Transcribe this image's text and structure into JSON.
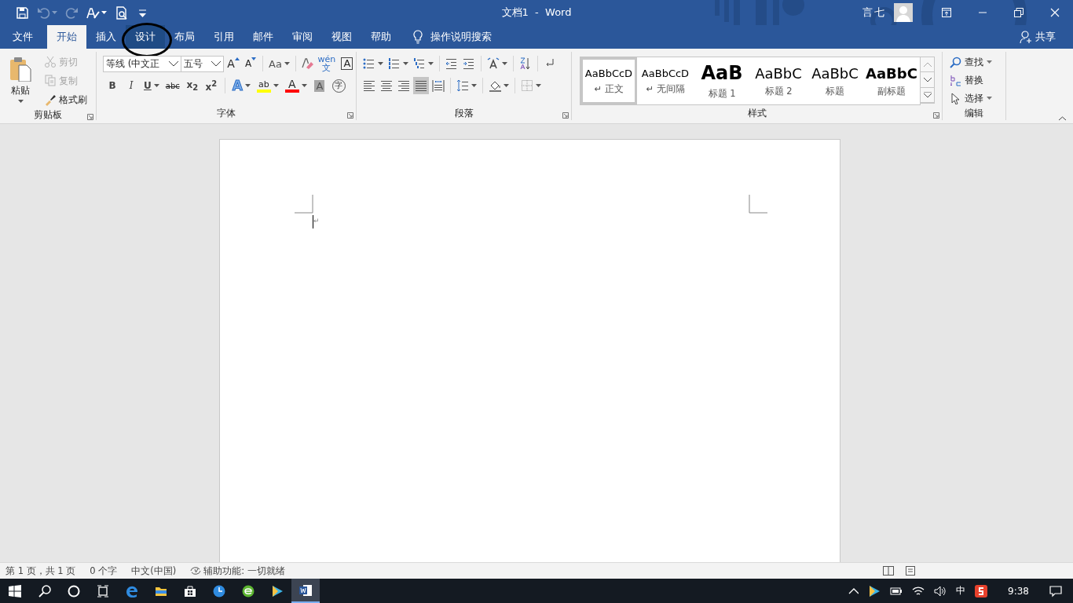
{
  "quick_access": [
    {
      "kind": "save",
      "disabled": false
    },
    {
      "kind": "undo",
      "disabled": true
    },
    {
      "kind": "redo",
      "disabled": true
    },
    {
      "kind": "spelling",
      "disabled": false
    },
    {
      "kind": "print-preview",
      "disabled": false
    },
    {
      "kind": "customize",
      "disabled": false
    }
  ],
  "window": {
    "title": "文档1  -  Word",
    "user": "言七"
  },
  "tabs": [
    {
      "label": "文件",
      "selected": false,
      "highlighted": false
    },
    {
      "label": "开始",
      "selected": true,
      "highlighted": false
    },
    {
      "label": "插入",
      "selected": false,
      "highlighted": false
    },
    {
      "label": "设计",
      "selected": false,
      "highlighted": true
    },
    {
      "label": "布局",
      "selected": false,
      "highlighted": false
    },
    {
      "label": "引用",
      "selected": false,
      "highlighted": false
    },
    {
      "label": "邮件",
      "selected": false,
      "highlighted": false
    },
    {
      "label": "审阅",
      "selected": false,
      "highlighted": false
    },
    {
      "label": "视图",
      "selected": false,
      "highlighted": false
    },
    {
      "label": "帮助",
      "selected": false,
      "highlighted": false
    }
  ],
  "tell_me": "操作说明搜索",
  "share": "共享",
  "clipboard": {
    "title": "剪贴板",
    "paste": "粘贴",
    "items": [
      {
        "kind": "cut",
        "label": "剪切",
        "disabled": true
      },
      {
        "kind": "copy",
        "label": "复制",
        "disabled": true
      },
      {
        "kind": "format-painter",
        "label": "格式刷",
        "disabled": false
      }
    ]
  },
  "font": {
    "title": "字体",
    "font_name": "等线 (中文正",
    "font_size": "五号",
    "row_1": [
      {
        "kind": "grow",
        "label": "A"
      },
      {
        "kind": "shrink",
        "label": "A"
      },
      {
        "kind": "case",
        "label": "Aa"
      },
      {
        "kind": "clear"
      },
      {
        "kind": "phonetic",
        "label": "wén文"
      },
      {
        "kind": "border",
        "label": "A"
      }
    ],
    "row_2": [
      {
        "kind": "bold",
        "label": "B"
      },
      {
        "kind": "italic",
        "label": "I"
      },
      {
        "kind": "underline",
        "label": "U"
      },
      {
        "kind": "strike",
        "label": "abc"
      },
      {
        "kind": "sub",
        "label": "x$_{2}$"
      },
      {
        "kind": "super",
        "label": "x$^{2}$"
      },
      {
        "kind": "effects",
        "label": "A"
      },
      {
        "kind": "highlight",
        "label": "ab",
        "color": "#ffff00"
      },
      {
        "kind": "color",
        "label": "A",
        "color": "#ff0000"
      },
      {
        "kind": "shading",
        "label": "A"
      },
      {
        "kind": "enclose",
        "label": "字"
      }
    ]
  },
  "paragraph": {
    "title": "段落",
    "row_1": [
      {
        "kind": "bullets"
      },
      {
        "kind": "numbering"
      },
      {
        "kind": "multilevel"
      },
      {
        "kind": "outdent"
      },
      {
        "kind": "indent"
      },
      {
        "kind": "chinese-layout"
      },
      {
        "kind": "sort"
      },
      {
        "kind": "show-marks"
      }
    ],
    "alignment": [
      {
        "kind": "left",
        "selected": false
      },
      {
        "kind": "center",
        "selected": false
      },
      {
        "kind": "right",
        "selected": false
      },
      {
        "kind": "justify",
        "selected": true
      },
      {
        "kind": "distributed",
        "selected": false
      }
    ],
    "row_2": [
      {
        "kind": "line-spacing"
      },
      {
        "kind": "shading"
      },
      {
        "kind": "borders"
      }
    ]
  },
  "styles": {
    "title": "样式",
    "items": [
      {
        "preview": "AaBbCcD",
        "label": "↵ 正文",
        "kind": "normal",
        "selected": true
      },
      {
        "preview": "AaBbCcD",
        "label": "↵ 无间隔",
        "kind": "normal",
        "selected": false
      },
      {
        "preview": "AaB",
        "label": "标题 1",
        "kind": "heading1",
        "selected": false
      },
      {
        "preview": "AaBbC",
        "label": "标题 2",
        "kind": "heading2",
        "selected": false
      },
      {
        "preview": "AaBbC",
        "label": "标题",
        "kind": "title",
        "selected": false
      },
      {
        "preview": "AaBbC",
        "label": "副标题",
        "kind": "subtitle",
        "selected": false
      }
    ]
  },
  "editing": {
    "title": "编辑",
    "items": [
      {
        "kind": "find",
        "label": "查找"
      },
      {
        "kind": "replace",
        "label": "替换"
      },
      {
        "kind": "select",
        "label": "选择"
      }
    ]
  },
  "document": {
    "paragraph_mark": "↵"
  },
  "status_bar": [
    "第 1 页，共 1 页",
    "0 个字",
    "中文(中国)",
    "辅助功能: 一切就绪"
  ],
  "taskbar": {
    "apps": [
      {
        "kind": "edge",
        "active": false
      },
      {
        "kind": "explorer",
        "active": false
      },
      {
        "kind": "store",
        "active": false
      },
      {
        "kind": "clock",
        "active": false
      },
      {
        "kind": "browser",
        "active": false
      },
      {
        "kind": "player",
        "active": false
      },
      {
        "kind": "word",
        "active": true
      }
    ],
    "input_method": "中",
    "time": "9:38"
  }
}
